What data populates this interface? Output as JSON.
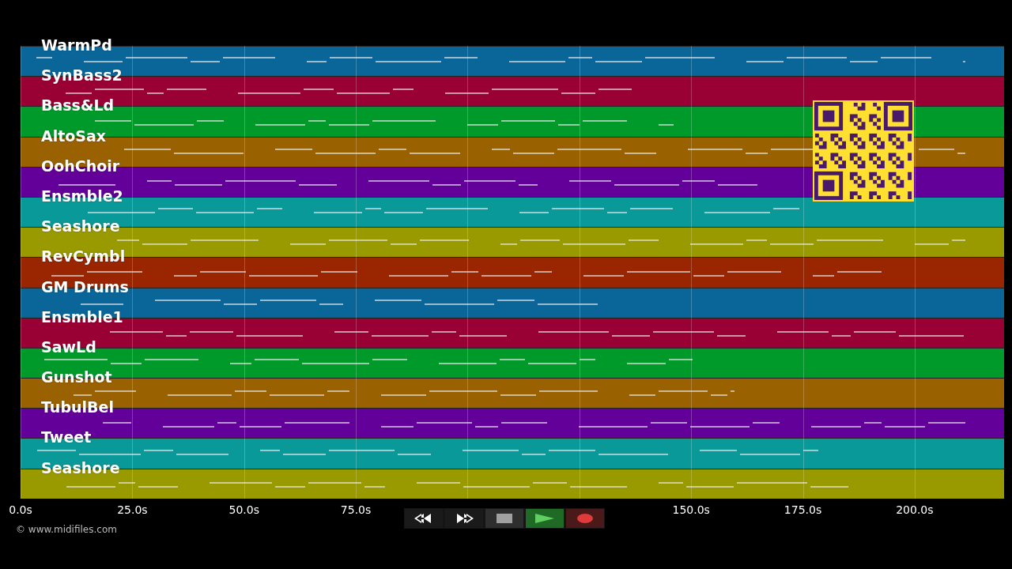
{
  "tracks": [
    {
      "name": "WarmPd",
      "color": "#0a6699"
    },
    {
      "name": "SynBass2",
      "color": "#990033"
    },
    {
      "name": "Bass&Ld",
      "color": "#009a2b"
    },
    {
      "name": "AltoSax",
      "color": "#996100"
    },
    {
      "name": "OohChoir",
      "color": "#630099"
    },
    {
      "name": "Ensmble2",
      "color": "#0a9999"
    },
    {
      "name": "Seashore",
      "color": "#999900"
    },
    {
      "name": "RevCymbl",
      "color": "#992600"
    },
    {
      "name": "GM Drums",
      "color": "#0a6699"
    },
    {
      "name": "Ensmble1",
      "color": "#990033"
    },
    {
      "name": "SawLd",
      "color": "#009a2b"
    },
    {
      "name": "Gunshot",
      "color": "#996100"
    },
    {
      "name": "TubulBel",
      "color": "#630099"
    },
    {
      "name": "Tweet",
      "color": "#0a9999"
    },
    {
      "name": "Seashore",
      "color": "#999900"
    }
  ],
  "time_axis": [
    {
      "label": "0.0s",
      "covered": false
    },
    {
      "label": "25.0s",
      "covered": false
    },
    {
      "label": "50.0s",
      "covered": false
    },
    {
      "label": "75.0s",
      "covered": false
    },
    {
      "covered": true
    },
    {
      "covered": true
    },
    {
      "label": "150.0s",
      "covered": false
    },
    {
      "label": "175.0s",
      "covered": false
    },
    {
      "label": "200.0s",
      "covered": false
    }
  ],
  "transport": [
    {
      "kind": "rewind"
    },
    {
      "kind": "forward"
    },
    {
      "kind": "stop"
    },
    {
      "kind": "play"
    },
    {
      "kind": "record"
    }
  ],
  "copyright": "© www.midifiles.com"
}
